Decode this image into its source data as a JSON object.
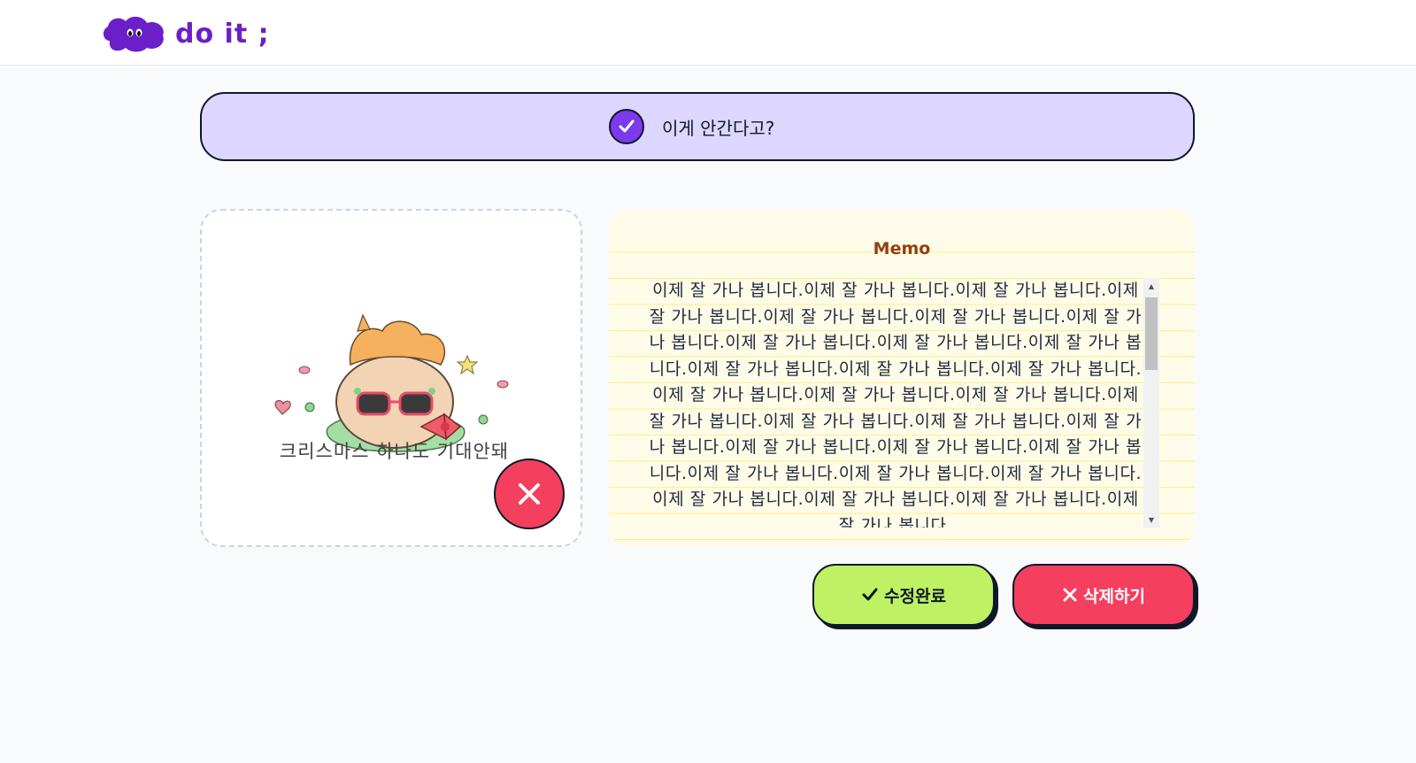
{
  "brand": {
    "logo_text": "do it ;"
  },
  "todo": {
    "title": "이게 안간다고?",
    "completed": true
  },
  "image": {
    "sticker_caption": "크리스마스 하나도 기대안돼"
  },
  "memo": {
    "title": "Memo",
    "content": "이제 잘 가나 봅니다.이제 잘 가나 봅니다.이제 잘 가나 봅니다.이제 잘 가나 봅니다.이제 잘 가나 봅니다.이제 잘 가나 봅니다.이제 잘 가나 봅니다.이제 잘 가나 봅니다.이제 잘 가나 봅니다.이제 잘 가나 봅니다.이제 잘 가나 봅니다.이제 잘 가나 봅니다.이제 잘 가나 봅니다.이제 잘 가나 봅니다.이제 잘 가나 봅니다.이제 잘 가나 봅니다.이제 잘 가나 봅니다.이제 잘 가나 봅니다.이제 잘 가나 봅니다.이제 잘 가나 봅니다.이제 잘 가나 봅니다.이제 잘 가나 봅니다.이제 잘 가나 봅니다.이제 잘 가나 봅니다.이제 잘 가나 봅니다.이제 잘 가나 봅니다.이제 잘 가나 봅니다.이제 잘 가나 봅니다.이제 잘 가나 봅니다.이제 잘 가나 봅니다."
  },
  "actions": {
    "save_label": "수정완료",
    "delete_label": "삭제하기"
  },
  "colors": {
    "brand": "#6a1fc8",
    "todo_bg": "#ddd6fe",
    "check": "#7c3aed",
    "memo_bg": "#fefce8",
    "memo_title": "#92400e",
    "save": "#bef264",
    "delete": "#f43f5e"
  },
  "icons": {
    "logo": "cloud-eyes-icon",
    "check": "check-icon",
    "remove_image": "close-icon",
    "save": "checkmark-icon",
    "delete": "x-icon"
  }
}
